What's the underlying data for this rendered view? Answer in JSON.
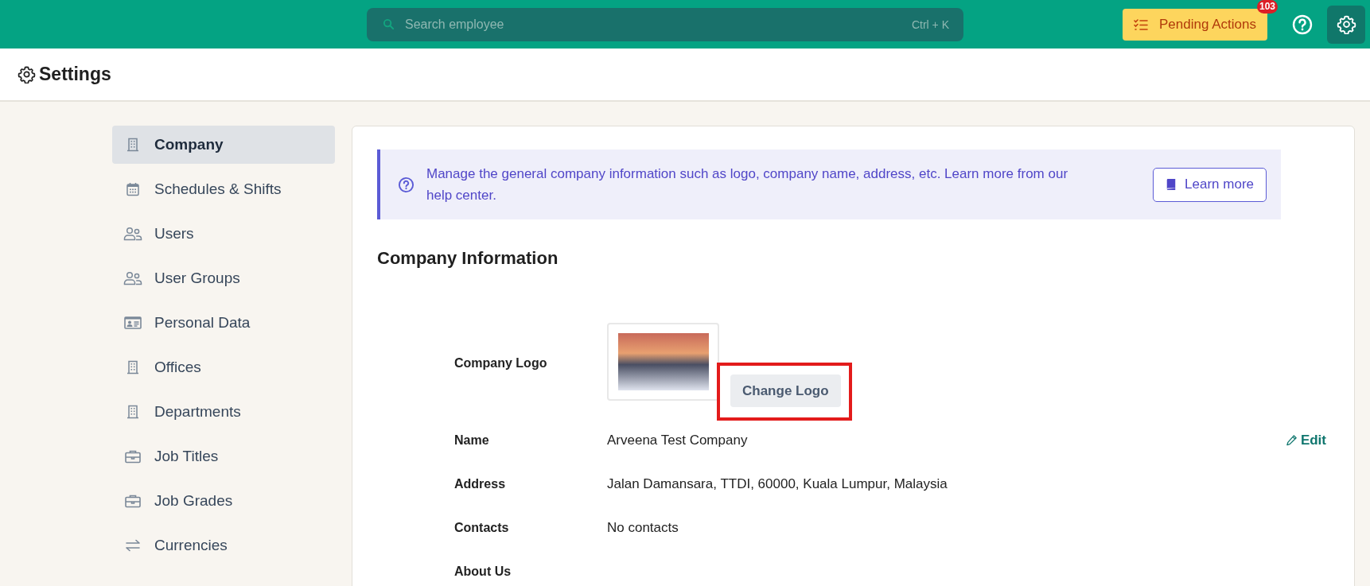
{
  "topbar": {
    "search": {
      "placeholder": "Search employee",
      "shortcut": "Ctrl + K"
    },
    "pending_actions": {
      "label": "Pending Actions",
      "badge": "103"
    }
  },
  "header": {
    "title": "Settings"
  },
  "sidebar": {
    "items": [
      {
        "label": "Company",
        "kind": "building",
        "selected": true
      },
      {
        "label": "Schedules & Shifts",
        "kind": "calendar",
        "selected": false
      },
      {
        "label": "Users",
        "kind": "people",
        "selected": false
      },
      {
        "label": "User Groups",
        "kind": "people",
        "selected": false
      },
      {
        "label": "Personal Data",
        "kind": "card",
        "selected": false
      },
      {
        "label": "Offices",
        "kind": "building",
        "selected": false
      },
      {
        "label": "Departments",
        "kind": "building",
        "selected": false
      },
      {
        "label": "Job Titles",
        "kind": "briefcase",
        "selected": false
      },
      {
        "label": "Job Grades",
        "kind": "briefcase",
        "selected": false
      },
      {
        "label": "Currencies",
        "kind": "swap",
        "selected": false
      }
    ]
  },
  "banner": {
    "text": "Manage the general company information such as logo, company name, address, etc. Learn more from our help center.",
    "button": "Learn more"
  },
  "section": {
    "title": "Company Information",
    "logo": {
      "label": "Company Logo",
      "button": "Change Logo",
      "highlighted": true
    },
    "fields": [
      {
        "label": "Name",
        "value": "Arveena Test Company",
        "action": "Edit"
      },
      {
        "label": "Address",
        "value": "Jalan Damansara, TTDI, 60000, Kuala Lumpur, Malaysia"
      },
      {
        "label": "Contacts",
        "value": "No contacts"
      },
      {
        "label": "About Us"
      }
    ]
  }
}
